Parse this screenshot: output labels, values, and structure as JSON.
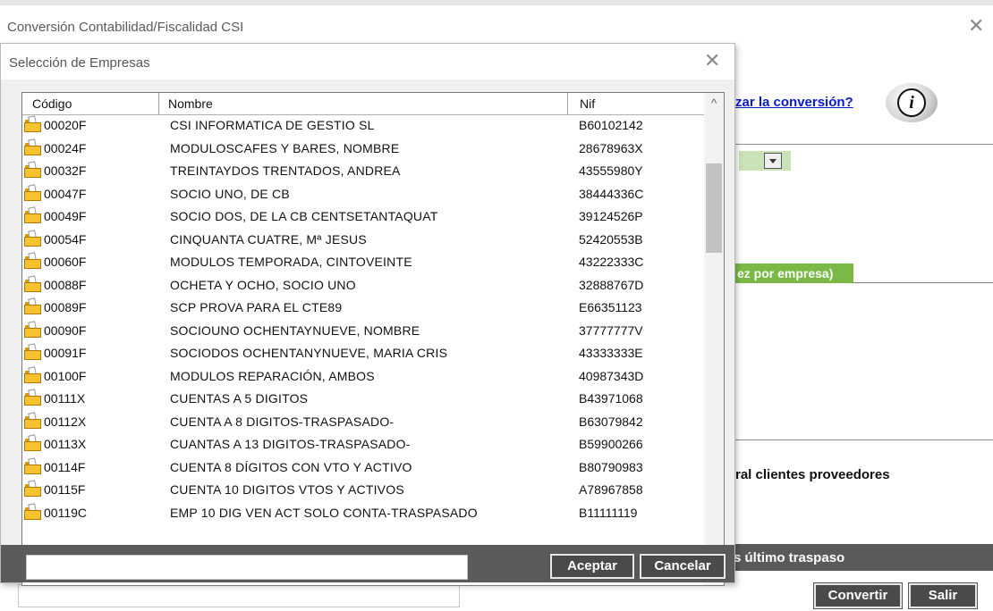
{
  "main": {
    "title": "Conversión Contabilidad/Fiscalidad CSI",
    "close_glyph": "✕",
    "question_link": "zar la conversión?",
    "info_icon": "i",
    "green_tab_label": "ez por empresa)",
    "clients_label": "ral clientes proveedores",
    "status_bar_label": "s último traspaso",
    "input_value": "",
    "convert_button": "Convertir",
    "exit_button": "Salir"
  },
  "dialog": {
    "title": "Selección de Empresas",
    "close_glyph": "✕",
    "columns": {
      "codigo": "Código",
      "nombre": "Nombre",
      "nif": "Nif"
    },
    "rows": [
      {
        "code": "00020F",
        "name": "CSI INFORMATICA DE GESTIO SL",
        "nif": "B60102142"
      },
      {
        "code": "00024F",
        "name": "MODULOSCAFES Y BARES, NOMBRE",
        "nif": "28678963X"
      },
      {
        "code": "00032F",
        "name": "TREINTAYDOS TRENTADOS, ANDREA",
        "nif": "43555980Y"
      },
      {
        "code": "00047F",
        "name": "SOCIO UNO, DE CB",
        "nif": "38444336C"
      },
      {
        "code": "00049F",
        "name": "SOCIO DOS, DE LA CB CENTSETANTAQUAT",
        "nif": "39124526P"
      },
      {
        "code": "00054F",
        "name": "CINQUANTA CUATRE, Mª JESUS",
        "nif": "52420553B"
      },
      {
        "code": "00060F",
        "name": "MODULOS TEMPORADA, CINTOVEINTE",
        "nif": "43222333C"
      },
      {
        "code": "00088F",
        "name": "OCHETA Y OCHO, SOCIO UNO",
        "nif": "32888767D"
      },
      {
        "code": "00089F",
        "name": "SCP PROVA PARA EL CTE89",
        "nif": "E66351123"
      },
      {
        "code": "00090F",
        "name": "SOCIOUNO OCHENTAYNUEVE, NOMBRE",
        "nif": "37777777V"
      },
      {
        "code": "00091F",
        "name": "SOCIODOS OCHENTANYNUEVE, MARIA CRIS",
        "nif": "43333333E"
      },
      {
        "code": "00100F",
        "name": "MODULOS REPARACIÓN, AMBOS",
        "nif": "40987343D"
      },
      {
        "code": "00111X",
        "name": "CUENTAS A 5 DIGITOS",
        "nif": "B43971068"
      },
      {
        "code": "00112X",
        "name": "CUENTA A 8 DIGITOS-TRASPASADO-",
        "nif": "B63079842"
      },
      {
        "code": "00113X",
        "name": "CUANTAS A 13 DIGITOS-TRASPASADO-",
        "nif": "B59900266"
      },
      {
        "code": "00114F",
        "name": "CUENTA 8 DÍGITOS CON VTO Y ACTIVO",
        "nif": "B80790983"
      },
      {
        "code": "00115F",
        "name": "CUENTA 10 DIGITOS VTOS Y ACTIVOS",
        "nif": "A78967858"
      },
      {
        "code": "00119C",
        "name": "EMP 10 DIG VEN ACT SOLO CONTA-TRASPASADO",
        "nif": "B11111119"
      }
    ],
    "row_icon": "company-folder-icon",
    "scroll_up_glyph": "^",
    "scroll_down_glyph": "v",
    "search_value": "",
    "accept_button": "Aceptar",
    "cancel_button": "Cancelar"
  }
}
